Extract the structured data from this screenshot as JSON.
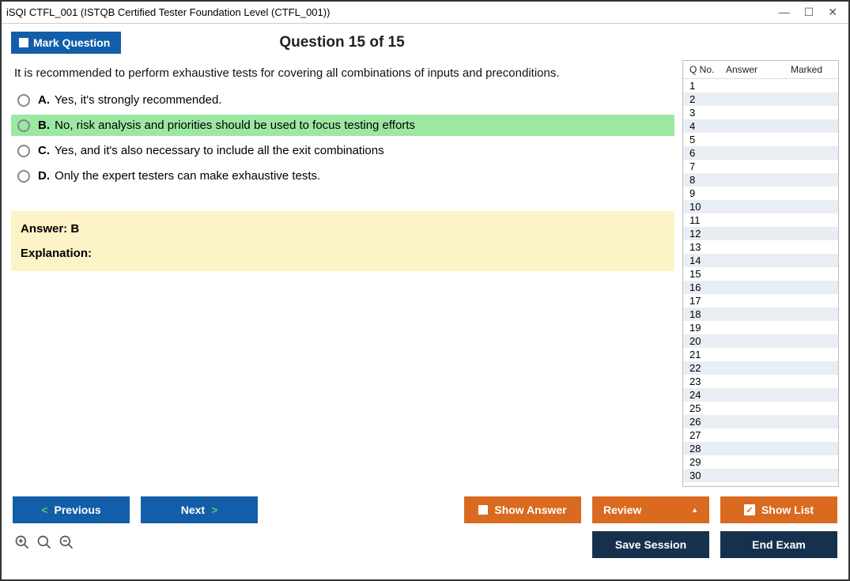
{
  "window": {
    "title": "iSQI CTFL_001 (ISTQB Certified Tester Foundation Level (CTFL_001))"
  },
  "header": {
    "mark_label": "Mark Question",
    "question_title": "Question 15 of 15"
  },
  "question": {
    "text": "It is recommended to perform exhaustive tests for covering all combinations of inputs and preconditions.",
    "options": {
      "a_letter": "A.",
      "a_text": " Yes, it's strongly recommended.",
      "b_letter": "B.",
      "b_text": " No, risk analysis and priorities should be used to focus testing efforts",
      "c_letter": "C.",
      "c_text": " Yes, and it's also necessary to include all the exit combinations",
      "d_letter": "D.",
      "d_text": " Only the expert testers can make exhaustive tests."
    }
  },
  "answer": {
    "line": "Answer: B",
    "explanation_label": "Explanation:"
  },
  "sidebar": {
    "h_q": "Q No.",
    "h_a": "Answer",
    "h_m": "Marked",
    "rows": [
      "1",
      "2",
      "3",
      "4",
      "5",
      "6",
      "7",
      "8",
      "9",
      "10",
      "11",
      "12",
      "13",
      "14",
      "15",
      "16",
      "17",
      "18",
      "19",
      "20",
      "21",
      "22",
      "23",
      "24",
      "25",
      "26",
      "27",
      "28",
      "29",
      "30"
    ]
  },
  "footer": {
    "previous": "Previous",
    "next": "Next",
    "show_answer": "Show Answer",
    "review": "Review",
    "show_list": "Show List",
    "save_session": "Save Session",
    "end_exam": "End Exam"
  }
}
